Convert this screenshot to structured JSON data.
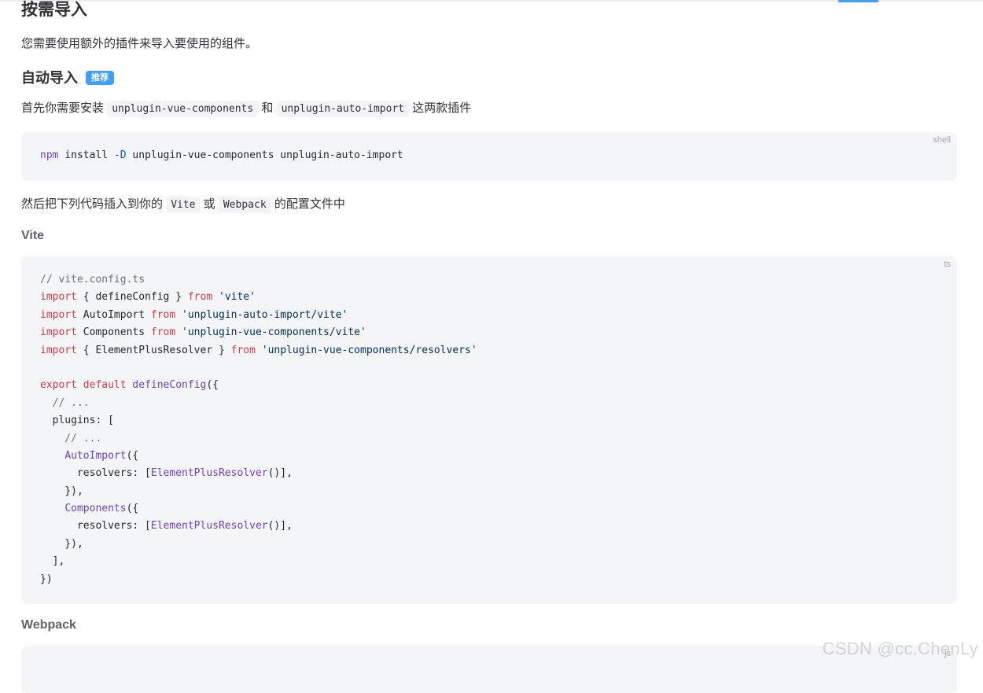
{
  "section": {
    "title": "按需导入",
    "intro": "您需要使用额外的插件来导入要使用的组件。"
  },
  "auto_import": {
    "title": "自动导入",
    "badge": "推荐",
    "sentence_prefix": "首先你需要安装",
    "pkg1": "unplugin-vue-components",
    "connector": "和",
    "pkg2": "unplugin-auto-import",
    "sentence_suffix": "这两款插件"
  },
  "install_block": {
    "lang": "shell",
    "tokens": [
      {
        "t": "npm",
        "c": "tok-fn"
      },
      {
        "t": " install ",
        "c": "tok-plain"
      },
      {
        "t": "-D",
        "c": "tok-opt"
      },
      {
        "t": " unplugin-vue-components unplugin-auto-import",
        "c": "tok-plain"
      }
    ]
  },
  "config_sentence": {
    "prefix": "然后把下列代码插入到你的",
    "vite": "Vite",
    "or": "或",
    "webpack": "Webpack",
    "suffix": "的配置文件中"
  },
  "vite_heading": "Vite",
  "vite_block": {
    "lang": "ts",
    "lines": [
      [
        {
          "t": "// vite.config.ts",
          "c": "tok-cm"
        }
      ],
      [
        {
          "t": "import",
          "c": "tok-kw"
        },
        {
          "t": " { defineConfig } ",
          "c": "tok-plain"
        },
        {
          "t": "from",
          "c": "tok-kw"
        },
        {
          "t": " 'vite'",
          "c": "tok-str"
        }
      ],
      [
        {
          "t": "import",
          "c": "tok-kw"
        },
        {
          "t": " AutoImport ",
          "c": "tok-plain"
        },
        {
          "t": "from",
          "c": "tok-kw"
        },
        {
          "t": " 'unplugin-auto-import/vite'",
          "c": "tok-str"
        }
      ],
      [
        {
          "t": "import",
          "c": "tok-kw"
        },
        {
          "t": " Components ",
          "c": "tok-plain"
        },
        {
          "t": "from",
          "c": "tok-kw"
        },
        {
          "t": " 'unplugin-vue-components/vite'",
          "c": "tok-str"
        }
      ],
      [
        {
          "t": "import",
          "c": "tok-kw"
        },
        {
          "t": " { ElementPlusResolver } ",
          "c": "tok-plain"
        },
        {
          "t": "from",
          "c": "tok-kw"
        },
        {
          "t": " 'unplugin-vue-components/resolvers'",
          "c": "tok-str"
        }
      ],
      [],
      [
        {
          "t": "export",
          "c": "tok-kw"
        },
        {
          "t": " ",
          "c": "tok-plain"
        },
        {
          "t": "default",
          "c": "tok-kw"
        },
        {
          "t": " ",
          "c": "tok-plain"
        },
        {
          "t": "defineConfig",
          "c": "tok-fn"
        },
        {
          "t": "({",
          "c": "tok-plain"
        }
      ],
      [
        {
          "t": "  // ...",
          "c": "tok-cm"
        }
      ],
      [
        {
          "t": "  plugins: [",
          "c": "tok-plain"
        }
      ],
      [
        {
          "t": "    // ...",
          "c": "tok-cm"
        }
      ],
      [
        {
          "t": "    ",
          "c": "tok-plain"
        },
        {
          "t": "AutoImport",
          "c": "tok-fn"
        },
        {
          "t": "({",
          "c": "tok-plain"
        }
      ],
      [
        {
          "t": "      resolvers: [",
          "c": "tok-plain"
        },
        {
          "t": "ElementPlusResolver",
          "c": "tok-fn"
        },
        {
          "t": "()],",
          "c": "tok-plain"
        }
      ],
      [
        {
          "t": "    }),",
          "c": "tok-plain"
        }
      ],
      [
        {
          "t": "    ",
          "c": "tok-plain"
        },
        {
          "t": "Components",
          "c": "tok-fn"
        },
        {
          "t": "({",
          "c": "tok-plain"
        }
      ],
      [
        {
          "t": "      resolvers: [",
          "c": "tok-plain"
        },
        {
          "t": "ElementPlusResolver",
          "c": "tok-fn"
        },
        {
          "t": "()],",
          "c": "tok-plain"
        }
      ],
      [
        {
          "t": "    }),",
          "c": "tok-plain"
        }
      ],
      [
        {
          "t": "  ],",
          "c": "tok-plain"
        }
      ],
      [
        {
          "t": "})",
          "c": "tok-plain"
        }
      ]
    ]
  },
  "webpack_heading": "Webpack",
  "webpack_block": {
    "lang": "js"
  },
  "watermark": "CSDN @cc.ChenLy"
}
